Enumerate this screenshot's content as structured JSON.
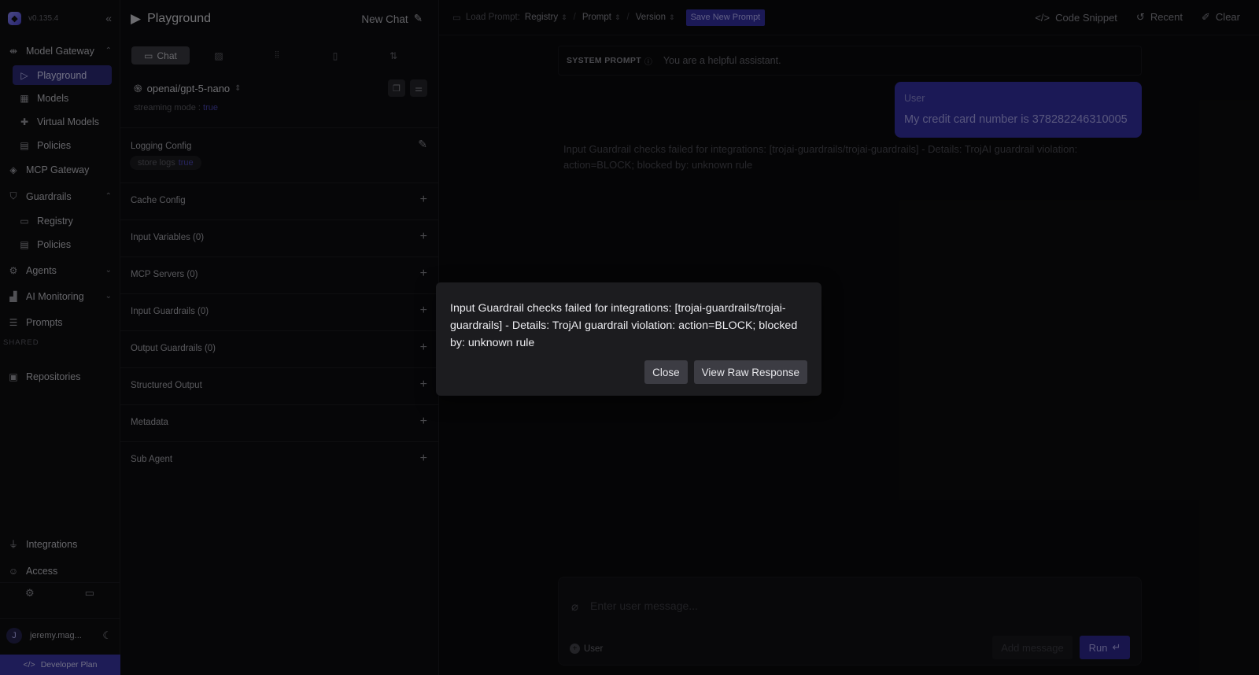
{
  "app": {
    "version": "v0.135.4",
    "logo": "letter-mark-logo"
  },
  "sidebar": {
    "items": [
      {
        "label": "Model Gateway",
        "icon": "gateway-icon"
      },
      {
        "label": "Playground",
        "icon": "play-icon"
      },
      {
        "label": "Models",
        "icon": "table-icon"
      },
      {
        "label": "Virtual Models",
        "icon": "puzzle-icon"
      },
      {
        "label": "Policies",
        "icon": "document-icon"
      },
      {
        "label": "MCP Gateway",
        "icon": "mcp-icon"
      },
      {
        "label": "Guardrails",
        "icon": "shield-icon"
      },
      {
        "label": "Registry",
        "icon": "folder-icon"
      },
      {
        "label": "Policies",
        "icon": "document-icon"
      },
      {
        "label": "Agents",
        "icon": "robot-icon"
      },
      {
        "label": "AI Monitoring",
        "icon": "chart-icon"
      },
      {
        "label": "Prompts",
        "icon": "stack-icon"
      },
      {
        "label": "Repositories",
        "icon": "repo-icon"
      },
      {
        "label": "Integrations",
        "icon": "plug-icon"
      },
      {
        "label": "Access",
        "icon": "user-key-icon"
      }
    ],
    "section_shared": "SHARED",
    "user": {
      "initial": "J",
      "name": "jeremy.mag..."
    },
    "plan_label": "Developer Plan"
  },
  "config": {
    "title": "Playground",
    "new_chat": "New Chat",
    "tab_chat": "Chat",
    "model": "openai/gpt-5-nano",
    "streaming_label": "streaming mode :",
    "streaming_value": "true",
    "logging_label": "Logging Config",
    "store_logs_label": "store logs",
    "store_logs_value": "true",
    "sections": [
      "Cache Config",
      "Input Variables (0)",
      "MCP Servers (0)",
      "Input Guardrails (0)",
      "Output Guardrails (0)",
      "Structured Output",
      "Metadata",
      "Sub Agent"
    ]
  },
  "topbar": {
    "load_prompt": "Load Prompt:",
    "registry": "Registry",
    "prompt": "Prompt",
    "version": "Version",
    "save_new_prompt": "Save New Prompt",
    "code_snippet": "Code Snippet",
    "recent": "Recent",
    "clear": "Clear"
  },
  "chat": {
    "system_label": "SYSTEM PROMPT",
    "system_text": "You are a helpful assistant.",
    "user_role": "User",
    "user_text": "My credit card number is 378282246310005",
    "error_text": "Input Guardrail checks failed for integrations: [trojai-guardrails/trojai-guardrails] - Details: TrojAI guardrail violation: action=BLOCK; blocked by: unknown rule",
    "input_placeholder": "Enter user message...",
    "role_selector": "User",
    "add_message": "Add message",
    "run": "Run"
  },
  "dialog": {
    "message": "Input Guardrail checks failed for integrations: [trojai-guardrails/trojai-guardrails] - Details: TrojAI guardrail violation: action=BLOCK; blocked by: unknown rule",
    "close": "Close",
    "view_raw": "View Raw Response"
  },
  "colors": {
    "accent": "#3531a6",
    "active_nav": "#2c2b7a",
    "background": "#0b0b0d"
  }
}
